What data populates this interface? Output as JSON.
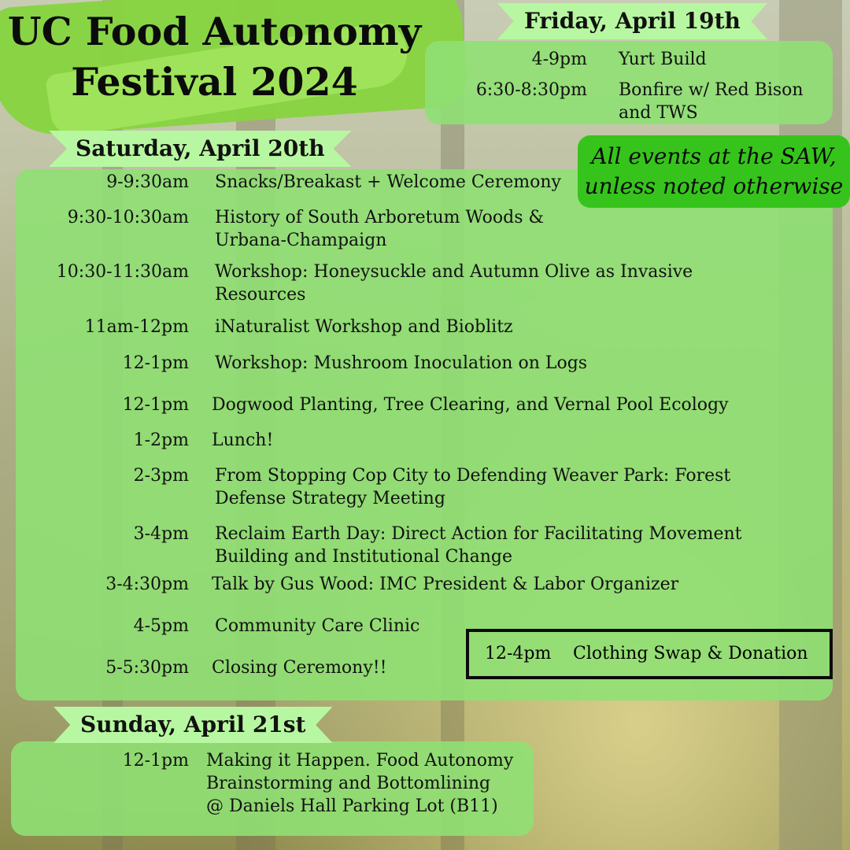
{
  "title": [
    "UC Food Autonomy",
    "Festival 2024"
  ],
  "note": [
    "All events at the SAW,",
    "unless noted otherwise"
  ],
  "colors": {
    "panel": "#8fe073",
    "ribbon": "#b8f7a1",
    "note": "#36c41c",
    "title_splash": "#86d43f"
  },
  "friday": {
    "heading": "Friday, April 19th",
    "events": [
      {
        "time": "4-9pm",
        "lines": [
          "Yurt Build"
        ]
      },
      {
        "time": "6:30-8:30pm",
        "lines": [
          "Bonfire w/ Red Bison",
          "and TWS"
        ]
      }
    ]
  },
  "saturday": {
    "heading": "Saturday, April 20th",
    "events": [
      {
        "time": "9-9:30am",
        "lines": [
          "Snacks/Breakast + Welcome Ceremony"
        ]
      },
      {
        "time": "9:30-10:30am",
        "lines": [
          "History of South Arboretum Woods &",
          "Urbana-Champaign"
        ]
      },
      {
        "time": "10:30-11:30am",
        "lines": [
          "Workshop: Honeysuckle and Autumn Olive as Invasive",
          "Resources"
        ]
      },
      {
        "time": "11am-12pm",
        "lines": [
          "iNaturalist Workshop and Bioblitz"
        ]
      },
      {
        "time": "12-1pm",
        "lines": [
          "Workshop: Mushroom Inoculation on Logs"
        ]
      },
      {
        "time": "12-1pm",
        "lines": [
          "Dogwood Planting,  Tree Clearing, and Vernal Pool Ecology"
        ]
      },
      {
        "time": "1-2pm",
        "lines": [
          "Lunch!"
        ]
      },
      {
        "time": "2-3pm",
        "lines": [
          "From Stopping Cop City to Defending Weaver Park: Forest",
          "Defense Strategy Meeting"
        ]
      },
      {
        "time": "3-4pm",
        "lines": [
          "Reclaim Earth Day: Direct Action for Facilitating Movement",
          "Building and Institutional Change"
        ]
      },
      {
        "time": "3-4:30pm",
        "lines": [
          "Talk by Gus Wood: IMC President & Labor Organizer"
        ]
      },
      {
        "time": "4-5pm",
        "lines": [
          "Community Care Clinic"
        ]
      },
      {
        "time": "5-5:30pm",
        "lines": [
          "Closing Ceremony!!"
        ]
      }
    ],
    "boxed_event": {
      "time": "12-4pm",
      "label": "Clothing Swap & Donation"
    }
  },
  "sunday": {
    "heading": "Sunday, April 21st",
    "events": [
      {
        "time": "12-1pm",
        "lines": [
          "Making it Happen. Food Autonomy",
          "Brainstorming and Bottomlining",
          "@ Daniels Hall Parking Lot (B11)"
        ]
      }
    ]
  }
}
